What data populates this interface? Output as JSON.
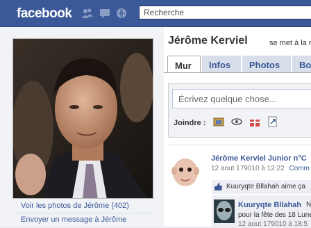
{
  "header": {
    "logo": "facebook",
    "search_placeholder": "Recherche",
    "icons": [
      "friends-icon",
      "messages-icon",
      "notifications-icon"
    ]
  },
  "left": {
    "links": [
      "Voir les photos de Jérôme (402)",
      "Envoyer un message à Jérôme"
    ]
  },
  "profile": {
    "name": "Jérôme Kerviel",
    "status": "se met à la r"
  },
  "tabs": [
    "Mur",
    "Infos",
    "Photos",
    "Bo"
  ],
  "composer": {
    "placeholder": "Écrivez quelque chose...",
    "attach_label": "Joindre :",
    "attach_icons": [
      "photo-icon",
      "video-icon",
      "gift-icon",
      "link-icon"
    ]
  },
  "feed": {
    "post1": {
      "author": "Jérôme Kerviel Junior n°C",
      "time": "12 aout 179010 à 12:22",
      "action": "Comm"
    },
    "like": {
      "text": "Kuuryqte Bllahah aime ça"
    },
    "post2": {
      "author": "Kuuryqte Bllahah",
      "text_start": "N",
      "text": "pour la fête des 18 Lune",
      "time": "12 aout 179010 à 18:5"
    }
  },
  "colors": {
    "brand": "#3b5998",
    "link": "#3b5998"
  }
}
